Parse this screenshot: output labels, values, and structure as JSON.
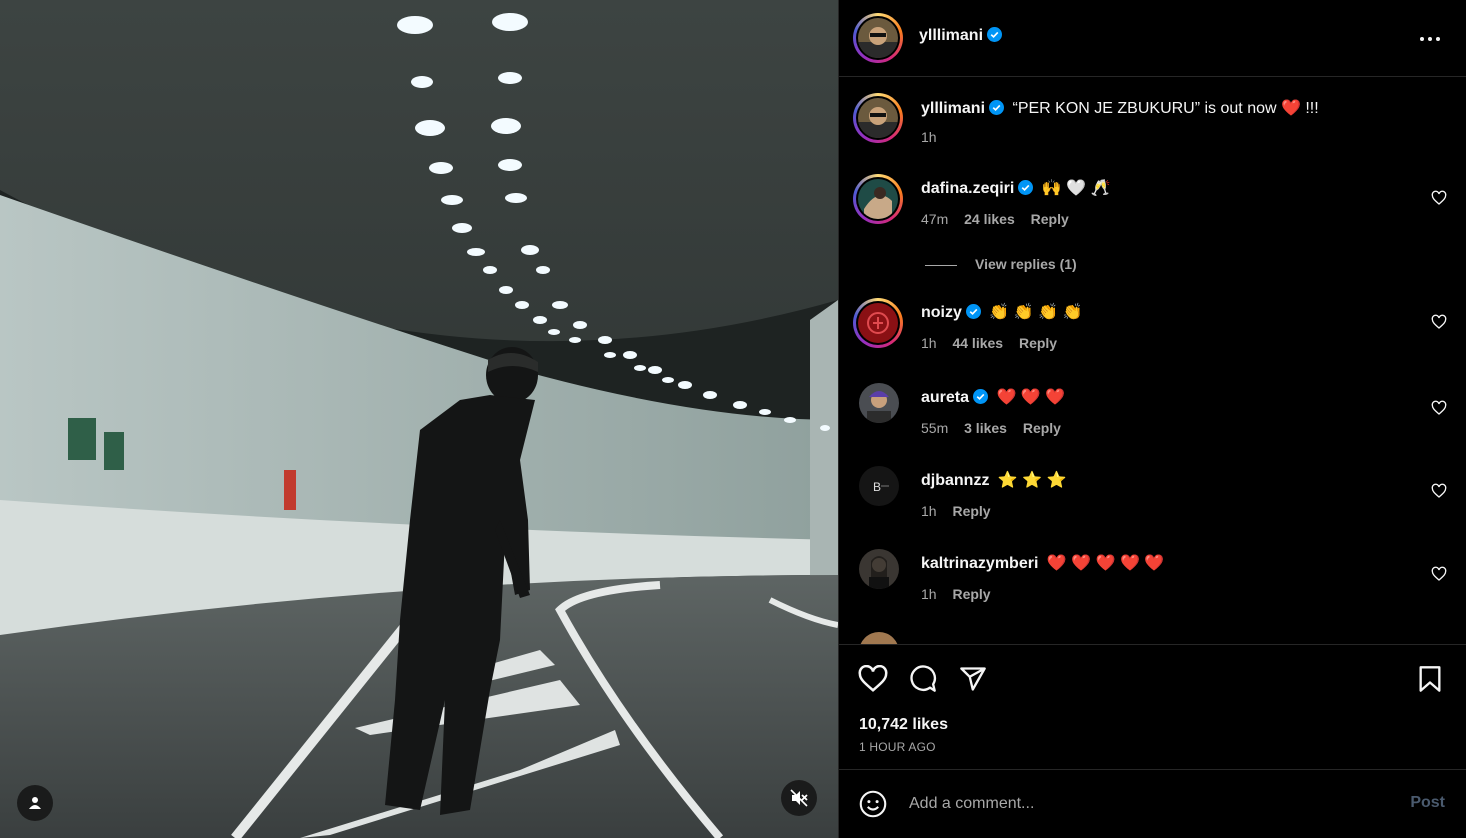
{
  "post": {
    "username": "ylllimani",
    "verified": true
  },
  "caption": {
    "username": "ylllimani",
    "text": "“PER KON JE ZBUKURU” is out now ❤️ !!!",
    "time": "1h"
  },
  "comments": [
    {
      "username": "dafina.zeqiri",
      "verified": true,
      "text": "🙌 🤍 🥂",
      "time": "47m",
      "likes": "24 likes",
      "reply": "Reply",
      "view_replies": "View replies (1)"
    },
    {
      "username": "noizy",
      "verified": true,
      "text": "👏 👏 👏 👏",
      "time": "1h",
      "likes": "44 likes",
      "reply": "Reply"
    },
    {
      "username": "aureta",
      "verified": true,
      "text": "❤️ ❤️ ❤️",
      "time": "55m",
      "likes": "3 likes",
      "reply": "Reply"
    },
    {
      "username": "djbannzz",
      "verified": false,
      "text": "⭐ ⭐ ⭐",
      "time": "1h",
      "reply": "Reply"
    },
    {
      "username": "kaltrinazymberi",
      "verified": false,
      "text": "❤️ ❤️ ❤️ ❤️ ❤️",
      "time": "1h",
      "reply": "Reply"
    }
  ],
  "actions": {
    "likes": "10,742 likes",
    "time_ago": "1 HOUR AGO"
  },
  "composer": {
    "placeholder": "Add a comment...",
    "post_label": "Post"
  },
  "icons": [
    "more-icon",
    "heart-icon",
    "comment-icon",
    "share-icon",
    "bookmark-icon",
    "emoji-icon",
    "user-tag-icon",
    "muted-icon",
    "verified-icon"
  ],
  "colors": {
    "accent": "#0095f6",
    "verified": "#0095f6",
    "background": "#000000",
    "muted_text": "#a8a8a8"
  }
}
